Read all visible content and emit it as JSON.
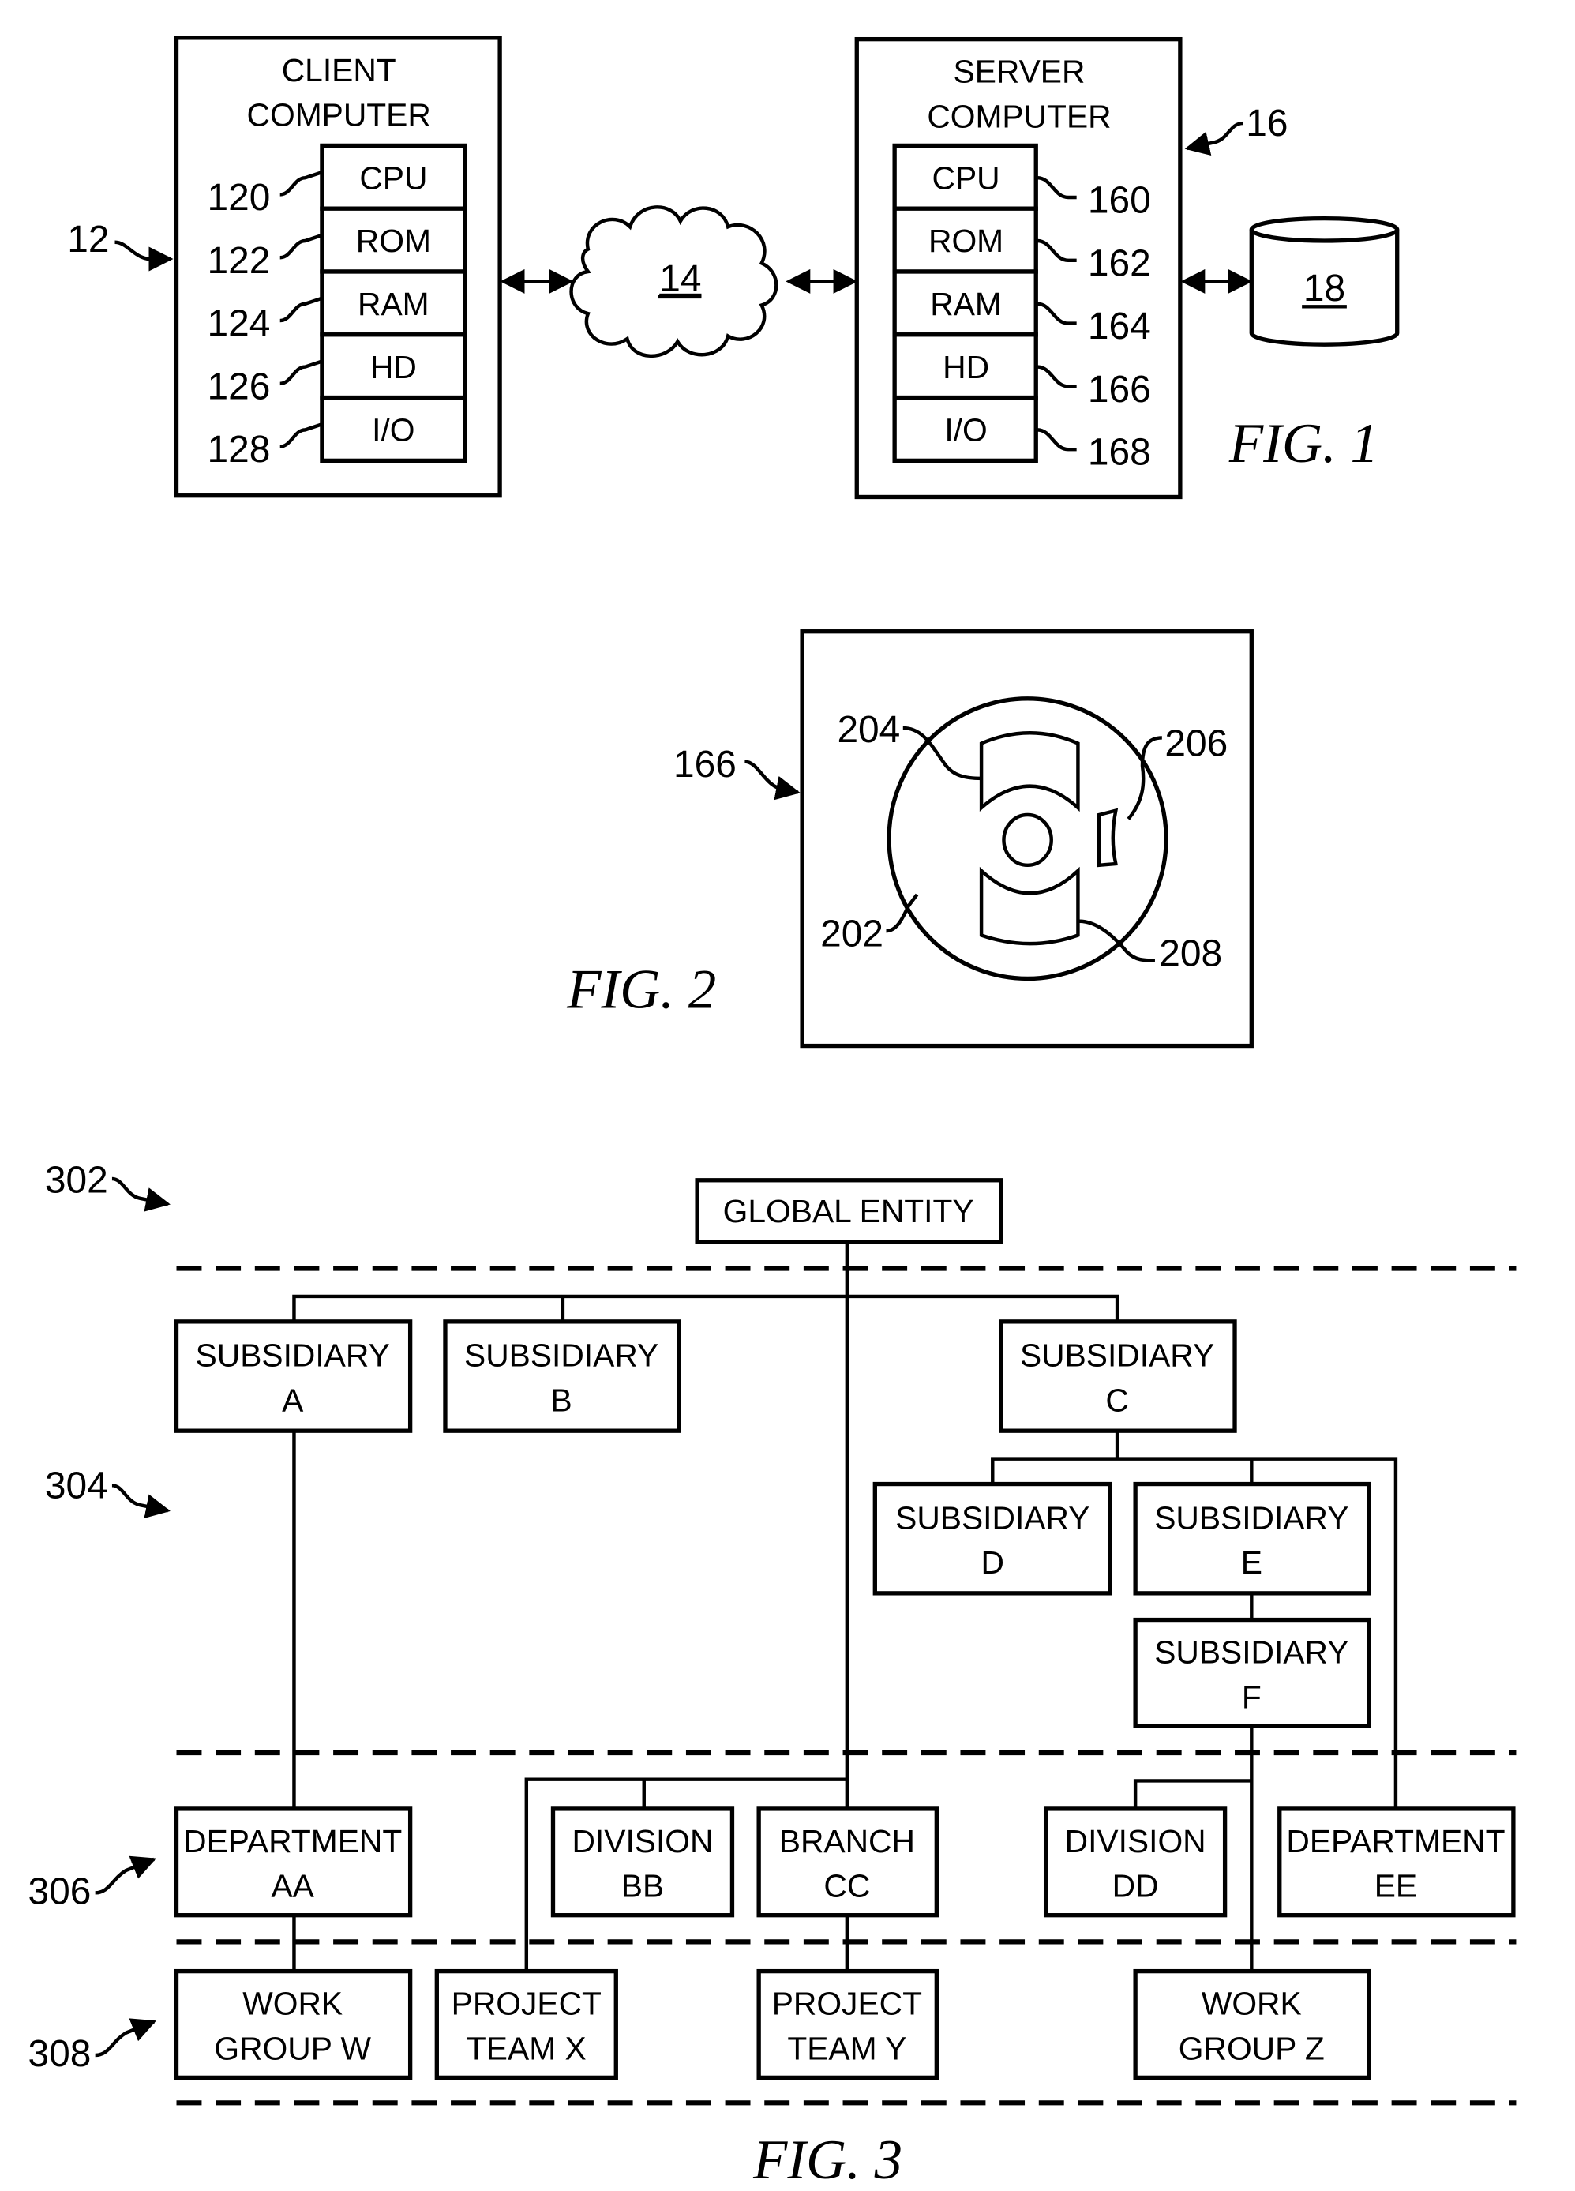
{
  "fig1": {
    "caption": "FIG. 1",
    "client": {
      "ref": "12",
      "title_line1": "CLIENT",
      "title_line2": "COMPUTER",
      "components": [
        {
          "label": "CPU",
          "ref": "120"
        },
        {
          "label": "ROM",
          "ref": "122"
        },
        {
          "label": "RAM",
          "ref": "124"
        },
        {
          "label": "HD",
          "ref": "126"
        },
        {
          "label": "I/O",
          "ref": "128"
        }
      ]
    },
    "network": {
      "ref": "14"
    },
    "server": {
      "ref": "16",
      "title_line1": "SERVER",
      "title_line2": "COMPUTER",
      "components": [
        {
          "label": "CPU",
          "ref": "160"
        },
        {
          "label": "ROM",
          "ref": "162"
        },
        {
          "label": "RAM",
          "ref": "164"
        },
        {
          "label": "HD",
          "ref": "166"
        },
        {
          "label": "I/O",
          "ref": "168"
        }
      ]
    },
    "database": {
      "ref": "18"
    }
  },
  "fig2": {
    "caption": "FIG. 2",
    "ref": "166",
    "labels": {
      "disk": "202",
      "upper_segment": "204",
      "head": "206",
      "lower_segment": "208"
    }
  },
  "fig3": {
    "caption": "FIG. 3",
    "tier_refs": {
      "t302": "302",
      "t304": "304",
      "t306": "306",
      "t308": "308"
    },
    "nodes": {
      "global": {
        "l1": "GLOBAL ENTITY"
      },
      "subA": {
        "l1": "SUBSIDIARY",
        "l2": "A"
      },
      "subB": {
        "l1": "SUBSIDIARY",
        "l2": "B"
      },
      "subC": {
        "l1": "SUBSIDIARY",
        "l2": "C"
      },
      "subD": {
        "l1": "SUBSIDIARY",
        "l2": "D"
      },
      "subE": {
        "l1": "SUBSIDIARY",
        "l2": "E"
      },
      "subF": {
        "l1": "SUBSIDIARY",
        "l2": "F"
      },
      "deptAA": {
        "l1": "DEPARTMENT",
        "l2": "AA"
      },
      "divBB": {
        "l1": "DIVISION",
        "l2": "BB"
      },
      "brCC": {
        "l1": "BRANCH",
        "l2": "CC"
      },
      "divDD": {
        "l1": "DIVISION",
        "l2": "DD"
      },
      "deptEE": {
        "l1": "DEPARTMENT",
        "l2": "EE"
      },
      "wgW": {
        "l1": "WORK",
        "l2": "GROUP W"
      },
      "ptX": {
        "l1": "PROJECT",
        "l2": "TEAM X"
      },
      "ptY": {
        "l1": "PROJECT",
        "l2": "TEAM Y"
      },
      "wgZ": {
        "l1": "WORK",
        "l2": "GROUP Z"
      }
    }
  }
}
